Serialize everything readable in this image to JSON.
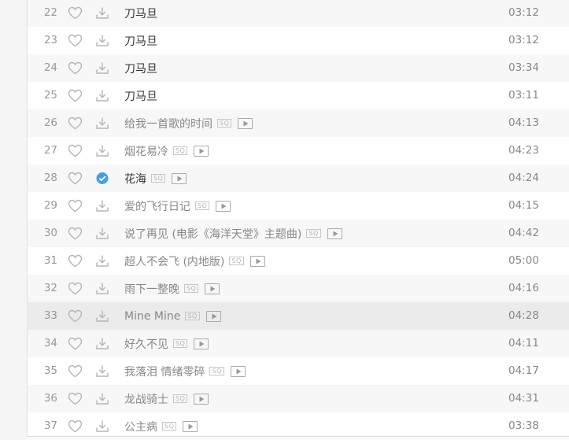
{
  "colors": {
    "downloaded_check": "#4a9fd8",
    "row_even": "#f7f7f7",
    "row_hover": "#ebebeb",
    "muted_text": "#888888",
    "dark_text": "#333333"
  },
  "tracks": [
    {
      "num": "22",
      "title": "刀马旦",
      "duration": "03:12",
      "sq": false,
      "mv": false,
      "downloaded": false,
      "dark": true
    },
    {
      "num": "23",
      "title": "刀马旦",
      "duration": "03:12",
      "sq": false,
      "mv": false,
      "downloaded": false,
      "dark": true
    },
    {
      "num": "24",
      "title": "刀马旦",
      "duration": "03:34",
      "sq": false,
      "mv": false,
      "downloaded": false,
      "dark": true
    },
    {
      "num": "25",
      "title": "刀马旦",
      "duration": "03:11",
      "sq": false,
      "mv": false,
      "downloaded": false,
      "dark": true
    },
    {
      "num": "26",
      "title": "给我一首歌的时间",
      "duration": "04:13",
      "sq": true,
      "mv": true,
      "downloaded": false,
      "dark": false
    },
    {
      "num": "27",
      "title": "烟花易冷",
      "duration": "04:23",
      "sq": true,
      "mv": true,
      "downloaded": false,
      "dark": false
    },
    {
      "num": "28",
      "title": "花海",
      "duration": "04:24",
      "sq": true,
      "mv": true,
      "downloaded": true,
      "dark": true
    },
    {
      "num": "29",
      "title": "爱的飞行日记",
      "duration": "04:15",
      "sq": true,
      "mv": true,
      "downloaded": false,
      "dark": false
    },
    {
      "num": "30",
      "title": "说了再见 (电影《海洋天堂》主题曲)",
      "duration": "04:42",
      "sq": true,
      "mv": true,
      "downloaded": false,
      "dark": false
    },
    {
      "num": "31",
      "title": "超人不会飞 (内地版)",
      "duration": "05:00",
      "sq": true,
      "mv": true,
      "downloaded": false,
      "dark": false
    },
    {
      "num": "32",
      "title": "雨下一整晚",
      "duration": "04:16",
      "sq": true,
      "mv": true,
      "downloaded": false,
      "dark": false
    },
    {
      "num": "33",
      "title": "Mine Mine",
      "duration": "04:28",
      "sq": true,
      "mv": true,
      "downloaded": false,
      "dark": false,
      "hover": true
    },
    {
      "num": "34",
      "title": "好久不见",
      "duration": "04:11",
      "sq": true,
      "mv": true,
      "downloaded": false,
      "dark": false
    },
    {
      "num": "35",
      "title": "我落泪 情绪零碎",
      "duration": "04:17",
      "sq": true,
      "mv": true,
      "downloaded": false,
      "dark": false
    },
    {
      "num": "36",
      "title": "龙战骑士",
      "duration": "04:31",
      "sq": true,
      "mv": true,
      "downloaded": false,
      "dark": false
    },
    {
      "num": "37",
      "title": "公主病",
      "duration": "03:38",
      "sq": true,
      "mv": true,
      "downloaded": false,
      "dark": false
    }
  ],
  "badges": {
    "sq_label": "SQ"
  }
}
